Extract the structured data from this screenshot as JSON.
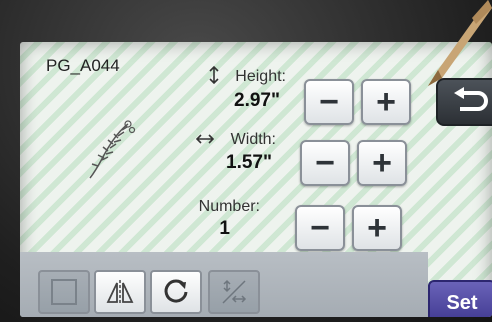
{
  "pattern": {
    "name": "PG_A044"
  },
  "height": {
    "label": "Height:",
    "value": "2.97\"",
    "icon": "vertical-arrow-icon"
  },
  "width": {
    "label": "Width:",
    "value": "1.57\"",
    "icon": "horizontal-arrow-icon"
  },
  "number": {
    "label": "Number:",
    "value": "1"
  },
  "buttons": {
    "minus": "−",
    "plus": "+"
  },
  "toolbar": {
    "items": [
      {
        "icon": "square-icon",
        "state": "disabled"
      },
      {
        "icon": "mirror-icon",
        "state": "enabled"
      },
      {
        "icon": "rotate-icon",
        "state": "enabled"
      },
      {
        "icon": "aspect-ratio-lock-icon",
        "state": "disabled"
      }
    ]
  },
  "actions": {
    "set_label": "Set",
    "back_icon": "return-arrow-icon"
  },
  "colors": {
    "screen_stripe_light": "#eef3ee",
    "screen_stripe_green": "#cfe7d3",
    "set_button": "#4b44a0",
    "toolbar": "#aeb5bb"
  }
}
